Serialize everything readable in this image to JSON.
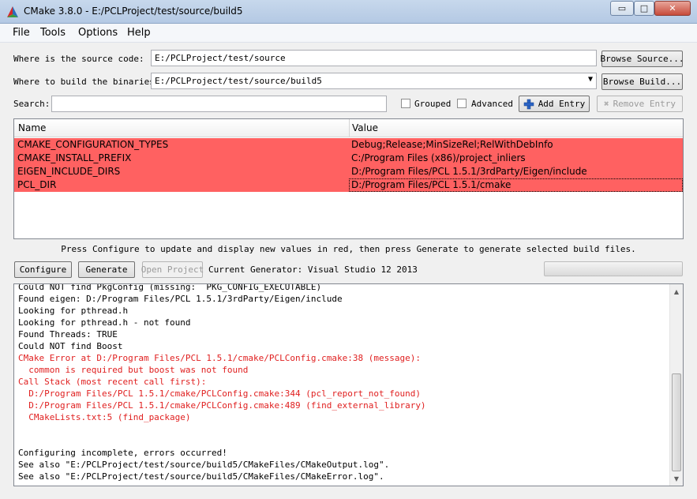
{
  "window": {
    "title": "CMake 3.8.0 - E:/PCLProject/test/source/build5",
    "minimize_glyph": "▭",
    "maximize_glyph": "□",
    "close_glyph": "✕"
  },
  "menu": [
    "File",
    "Tools",
    "Options",
    "Help"
  ],
  "source": {
    "label": "Where is the source code:",
    "value": "E:/PCLProject/test/source",
    "browse_label": "Browse Source..."
  },
  "build": {
    "label": "Where to build the binaries:",
    "value": "E:/PCLProject/test/source/build5",
    "browse_label": "Browse Build..."
  },
  "search": {
    "label": "Search:",
    "value": "",
    "grouped_label": "Grouped",
    "grouped_checked": false,
    "advanced_label": "Advanced",
    "advanced_checked": false,
    "add_entry_label": "Add Entry",
    "remove_entry_label": "Remove Entry"
  },
  "table": {
    "columns": [
      "Name",
      "Value"
    ],
    "rows": [
      {
        "name": "CMAKE_CONFIGURATION_TYPES",
        "value": "Debug;Release;MinSizeRel;RelWithDebInfo"
      },
      {
        "name": "CMAKE_INSTALL_PREFIX",
        "value": "C:/Program Files (x86)/project_inliers"
      },
      {
        "name": "EIGEN_INCLUDE_DIRS",
        "value": "D:/Program Files/PCL 1.5.1/3rdParty/Eigen/include"
      },
      {
        "name": "PCL_DIR",
        "value": "D:/Program Files/PCL 1.5.1/cmake"
      }
    ],
    "highlight_color": "#ff6161"
  },
  "info_text": "Press Configure to update and display new values in red, then press Generate to generate selected build files.",
  "actions": {
    "configure": "Configure",
    "generate": "Generate",
    "open_project": "Open Project",
    "generator_text": "Current Generator: Visual Studio 12 2013"
  },
  "progress": 0,
  "output_lines": [
    {
      "text": "Could NOT find PkgConfig (missing:  PKG_CONFIG_EXECUTABLE)",
      "error": false
    },
    {
      "text": "Found eigen: D:/Program Files/PCL 1.5.1/3rdParty/Eigen/include",
      "error": false
    },
    {
      "text": "Looking for pthread.h",
      "error": false
    },
    {
      "text": "Looking for pthread.h - not found",
      "error": false
    },
    {
      "text": "Found Threads: TRUE",
      "error": false
    },
    {
      "text": "Could NOT find Boost",
      "error": false
    },
    {
      "text": "CMake Error at D:/Program Files/PCL 1.5.1/cmake/PCLConfig.cmake:38 (message):",
      "error": true
    },
    {
      "text": "  common is required but boost was not found",
      "error": true
    },
    {
      "text": "Call Stack (most recent call first):",
      "error": true
    },
    {
      "text": "  D:/Program Files/PCL 1.5.1/cmake/PCLConfig.cmake:344 (pcl_report_not_found)",
      "error": true
    },
    {
      "text": "  D:/Program Files/PCL 1.5.1/cmake/PCLConfig.cmake:489 (find_external_library)",
      "error": true
    },
    {
      "text": "  CMakeLists.txt:5 (find_package)",
      "error": true
    },
    {
      "text": "",
      "error": false
    },
    {
      "text": "",
      "error": false
    },
    {
      "text": "Configuring incomplete, errors occurred!",
      "error": false
    },
    {
      "text": "See also \"E:/PCLProject/test/source/build5/CMakeFiles/CMakeOutput.log\".",
      "error": false
    },
    {
      "text": "See also \"E:/PCLProject/test/source/build5/CMakeFiles/CMakeError.log\".",
      "error": false
    }
  ],
  "colors": {
    "error_text": "#e02020",
    "changed_row": "#ff6161"
  }
}
